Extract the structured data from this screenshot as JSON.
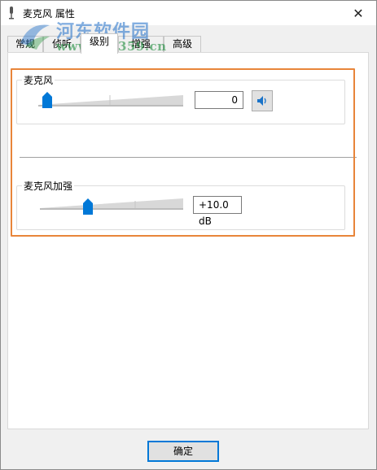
{
  "window": {
    "title": "麦克风 属性",
    "close_glyph": "✕"
  },
  "watermark": {
    "title": "河东软件园",
    "url": "www.pc0359.cn"
  },
  "tabs": [
    {
      "label": "常规",
      "active": false
    },
    {
      "label": "侦听",
      "active": false
    },
    {
      "label": "级别",
      "active": true
    },
    {
      "label": "增强",
      "active": false
    },
    {
      "label": "高级",
      "active": false
    }
  ],
  "levels": {
    "microphone": {
      "label": "麦克风",
      "value": "0",
      "level_percent": 0,
      "mute_icon": "speaker-icon"
    },
    "boost": {
      "label": "麦克风加强",
      "value": "+10.0 dB",
      "level_percent": 33
    }
  },
  "buttons": {
    "ok": "确定"
  },
  "colors": {
    "accent": "#0078d7",
    "highlight_box": "#e8853a"
  }
}
